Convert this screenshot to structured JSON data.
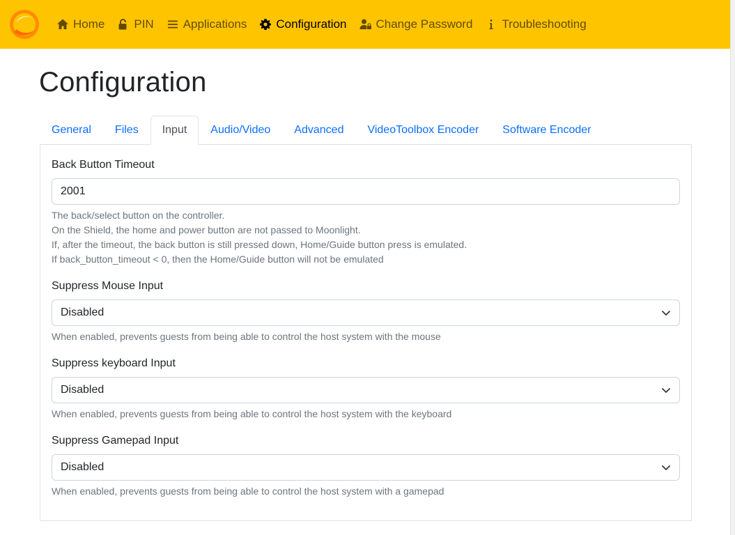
{
  "navbar": {
    "items": [
      {
        "label": "Home",
        "icon": "home-icon"
      },
      {
        "label": "PIN",
        "icon": "unlock-icon"
      },
      {
        "label": "Applications",
        "icon": "list-icon"
      },
      {
        "label": "Configuration",
        "icon": "gear-icon",
        "active": true
      },
      {
        "label": "Change Password",
        "icon": "user-lock-icon"
      },
      {
        "label": "Troubleshooting",
        "icon": "info-icon"
      }
    ],
    "accent_color": "#ffc400"
  },
  "page": {
    "title": "Configuration"
  },
  "tabs": [
    {
      "label": "General"
    },
    {
      "label": "Files"
    },
    {
      "label": "Input",
      "active": true
    },
    {
      "label": "Audio/Video"
    },
    {
      "label": "Advanced"
    },
    {
      "label": "VideoToolbox Encoder"
    },
    {
      "label": "Software Encoder"
    }
  ],
  "form": {
    "back_button_timeout": {
      "label": "Back Button Timeout",
      "value": "2001",
      "help": [
        "The back/select button on the controller.",
        "On the Shield, the home and power button are not passed to Moonlight.",
        "If, after the timeout, the back button is still pressed down, Home/Guide button press is emulated.",
        "If back_button_timeout < 0, then the Home/Guide button will not be emulated"
      ]
    },
    "suppress_mouse": {
      "label": "Suppress Mouse Input",
      "value": "Disabled",
      "help": "When enabled, prevents guests from being able to control the host system with the mouse"
    },
    "suppress_keyboard": {
      "label": "Suppress keyboard Input",
      "value": "Disabled",
      "help": "When enabled, prevents guests from being able to control the host system with the keyboard"
    },
    "suppress_gamepad": {
      "label": "Suppress Gamepad Input",
      "value": "Disabled",
      "help": "When enabled, prevents guests from being able to control the host system with a gamepad"
    }
  }
}
